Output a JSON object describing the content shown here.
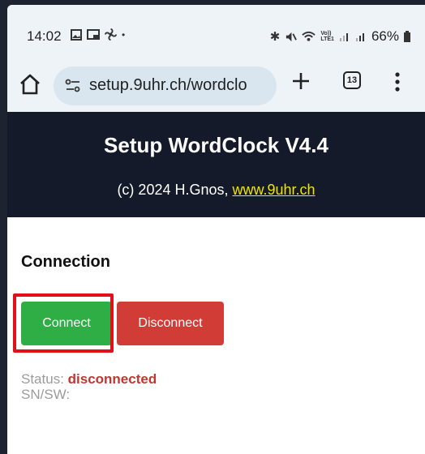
{
  "status_bar": {
    "time": "14:02",
    "icons_left": [
      "image-icon",
      "cast-icon",
      "fan-icon",
      "dot-icon"
    ],
    "icons_right": [
      "bluetooth-icon",
      "mute-icon",
      "wifi-icon",
      "volte-icon",
      "signal-icon",
      "signal-icon-2"
    ],
    "volte_label": "Vo))\nLTE1",
    "battery": "66%"
  },
  "browser": {
    "url": "setup.9uhr.ch/wordclo",
    "tab_count": "13"
  },
  "page": {
    "title": "Setup WordClock V4.4",
    "copyright_prefix": "(c) 2024 H.Gnos, ",
    "link_text": "www.9uhr.ch",
    "section_title": "Connection",
    "connect_label": "Connect",
    "disconnect_label": "Disconnect",
    "status_label": "Status: ",
    "status_value": "disconnected",
    "snsw_label": "SN/SW:"
  },
  "colors": {
    "header_bg": "#141a2a",
    "link": "#f2e500",
    "connect": "#2fae45",
    "disconnect": "#d23c37",
    "highlight": "#e3101a"
  }
}
